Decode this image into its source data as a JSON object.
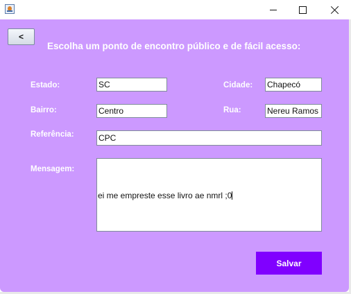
{
  "window": {
    "controls": {
      "minimize_icon": "minimize-icon",
      "maximize_icon": "maximize-icon",
      "close_icon": "close-icon"
    }
  },
  "colors": {
    "background": "#cc99ff",
    "accent": "#8000ff",
    "label_text": "#ffffff"
  },
  "back_button_label": "<",
  "heading": "Escolha um ponto de encontro público e de fácil acesso:",
  "form": {
    "estado": {
      "label": "Estado:",
      "value": "SC"
    },
    "cidade": {
      "label": "Cidade:",
      "value": "Chapecó"
    },
    "bairro": {
      "label": "Bairro:",
      "value": "Centro"
    },
    "rua": {
      "label": "Rua:",
      "value": "Nereu Ramos"
    },
    "referencia": {
      "label": "Referência:",
      "value": "CPC"
    },
    "mensagem": {
      "label": "Mensagem:",
      "value": "ei me empreste esse livro ae nmrl ;0"
    }
  },
  "save_button_label": "Salvar"
}
